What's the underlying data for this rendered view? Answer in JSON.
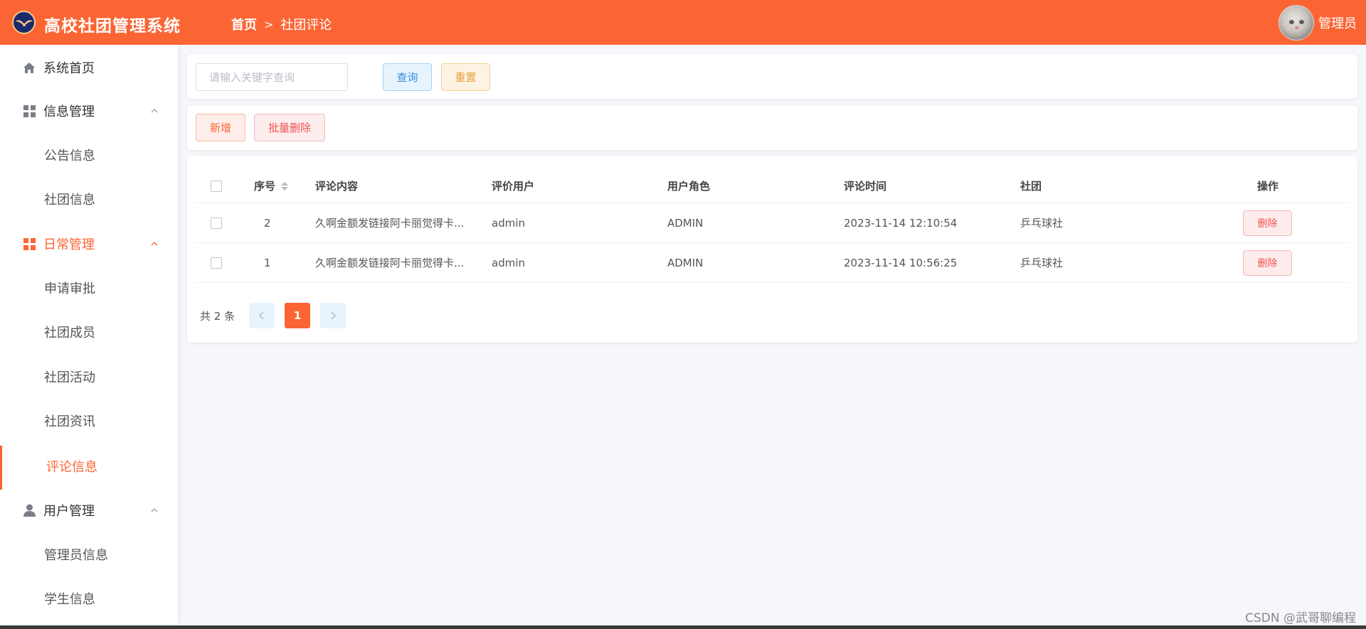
{
  "header": {
    "app_title": "高校社团管理系统",
    "breadcrumb_home": "首页",
    "breadcrumb_separator": ">",
    "breadcrumb_current": "社团评论",
    "user_name": "管理员",
    "bg_color": "#fb6534"
  },
  "sidebar": {
    "home": "系统首页",
    "group_info": {
      "label": "信息管理",
      "items": [
        "公告信息",
        "社团信息"
      ]
    },
    "group_daily": {
      "label": "日常管理",
      "items": [
        "申请审批",
        "社团成员",
        "社团活动",
        "社团资讯",
        "评论信息"
      ]
    },
    "group_user": {
      "label": "用户管理",
      "items": [
        "管理员信息",
        "学生信息"
      ]
    },
    "active_color": "#fb6534"
  },
  "search": {
    "placeholder": "请输入关键字查询",
    "query_label": "查询",
    "reset_label": "重置"
  },
  "actions": {
    "add_label": "新增",
    "batch_delete_label": "批量删除"
  },
  "table": {
    "headers": {
      "index": "序号",
      "content": "评论内容",
      "user": "评价用户",
      "role": "用户角色",
      "time": "评论时间",
      "club": "社团",
      "ops": "操作"
    },
    "rows": [
      {
        "index": "2",
        "content": "久啊金额发链接阿卡丽觉得卡...",
        "user": "admin",
        "role": "ADMIN",
        "time": "2023-11-14 12:10:54",
        "club": "乒乓球社",
        "delete_label": "删除"
      },
      {
        "index": "1",
        "content": "久啊金额发链接阿卡丽觉得卡...",
        "user": "admin",
        "role": "ADMIN",
        "time": "2023-11-14 10:56:25",
        "club": "乒乓球社",
        "delete_label": "删除"
      }
    ]
  },
  "pagination": {
    "total_text": "共 2 条",
    "current_page": "1"
  },
  "watermark": "CSDN @武哥聊编程"
}
